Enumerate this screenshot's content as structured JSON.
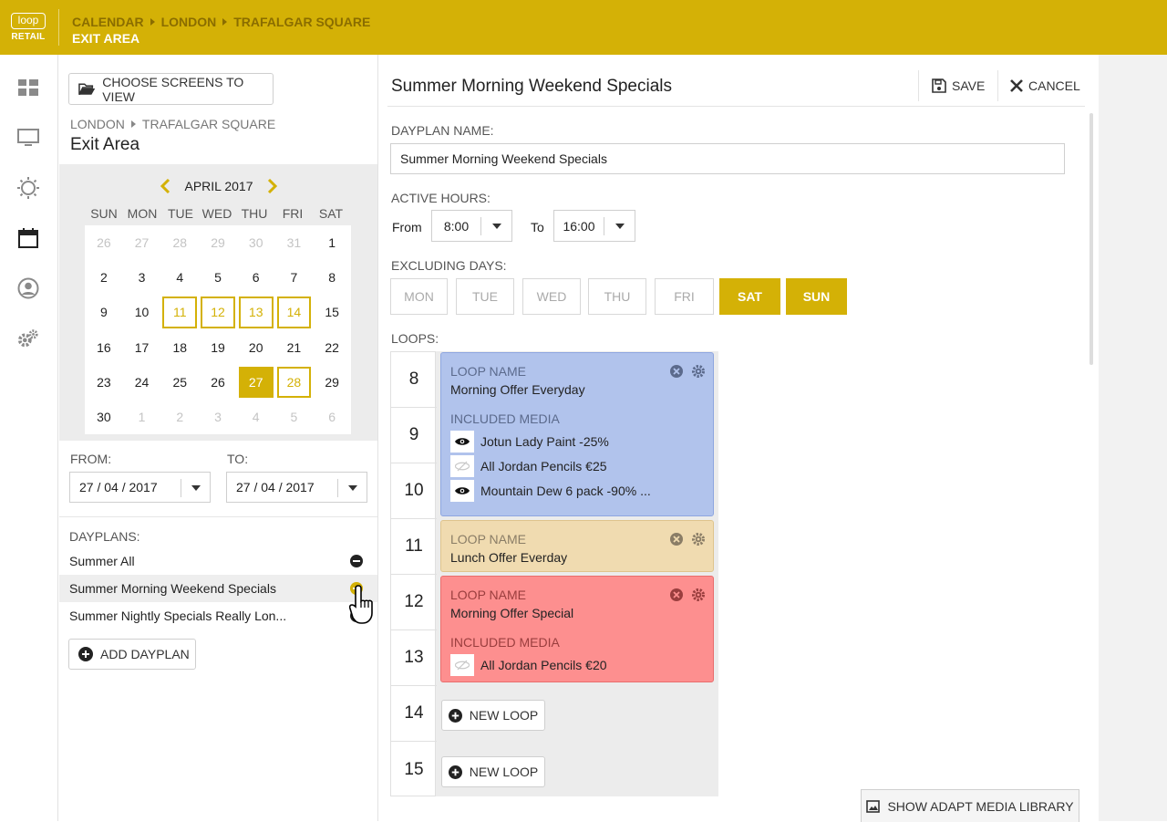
{
  "brand": {
    "logo_text": "loop",
    "logo_sub": "RETAIL",
    "accent": "#d4b106"
  },
  "breadcrumb": {
    "items": [
      "CALENDAR",
      "LONDON",
      "TRAFALGAR SQUARE"
    ],
    "title": "EXIT AREA"
  },
  "rail": {
    "icons": [
      "dashboard-icon",
      "screen-icon",
      "brightness-icon",
      "calendar-icon",
      "account-icon",
      "settings-icon"
    ]
  },
  "left": {
    "choose_label": "CHOOSE SCREENS TO VIEW",
    "location": {
      "city": "LONDON",
      "place": "TRAFALGAR SQUARE",
      "area": "Exit Area"
    },
    "calendar": {
      "month": "APRIL 2017",
      "weekdays": [
        "SUN",
        "MON",
        "TUE",
        "WED",
        "THU",
        "FRI",
        "SAT"
      ],
      "days": [
        [
          "26",
          "27",
          "28",
          "29",
          "30",
          "31",
          "1"
        ],
        [
          "2",
          "3",
          "4",
          "5",
          "6",
          "7",
          "8"
        ],
        [
          "9",
          "10",
          "11",
          "12",
          "13",
          "14",
          "15"
        ],
        [
          "16",
          "17",
          "18",
          "19",
          "20",
          "21",
          "22"
        ],
        [
          "23",
          "24",
          "25",
          "26",
          "27",
          "28",
          "29"
        ],
        [
          "30",
          "1",
          "2",
          "3",
          "4",
          "5",
          "6"
        ]
      ]
    },
    "from_label": "FROM:",
    "to_label": "TO:",
    "from_value": "27 / 04 / 2017",
    "to_value": "27 / 04 / 2017",
    "dayplans_label": "DAYPLANS:",
    "dayplans": [
      "Summer All",
      "Summer Morning Weekend Specials",
      "Summer Nightly Specials Really Lon..."
    ],
    "add_label": "ADD DAYPLAN"
  },
  "main": {
    "title": "Summer Morning Weekend Specials",
    "save_label": "SAVE",
    "cancel_label": "CANCEL",
    "name_label": "DAYPLAN NAME:",
    "name_value": "Summer Morning Weekend Specials",
    "hours_label": "ACTIVE HOURS:",
    "from_label": "From",
    "from_value": "8:00",
    "to_label": "To",
    "to_value": "16:00",
    "excl_label": "EXCLUDING DAYS:",
    "days": [
      "MON",
      "TUE",
      "WED",
      "THU",
      "FRI",
      "SAT",
      "SUN"
    ],
    "loops_label": "LOOPS:",
    "hours": [
      "8",
      "9",
      "10",
      "11",
      "12",
      "13",
      "14",
      "15"
    ],
    "loops": [
      {
        "name_label": "LOOP NAME",
        "name": "Morning Offer Everyday",
        "media_label": "INCLUDED MEDIA",
        "media": [
          "Jotun Lady Paint -25%",
          "All Jordan Pencils €25",
          "Mountain Dew 6 pack -90% ..."
        ],
        "color": "#b1c3ec"
      },
      {
        "name_label": "LOOP NAME",
        "name": "Lunch Offer Everday",
        "color": "#f0dbb0"
      },
      {
        "name_label": "LOOP NAME",
        "name": "Morning Offer Special",
        "media_label": "INCLUDED MEDIA",
        "media": [
          "All Jordan Pencils €20"
        ],
        "color": "#fd8f8f"
      }
    ],
    "new_loop_label": "NEW LOOP",
    "library_label": "SHOW ADAPT MEDIA LIBRARY"
  }
}
